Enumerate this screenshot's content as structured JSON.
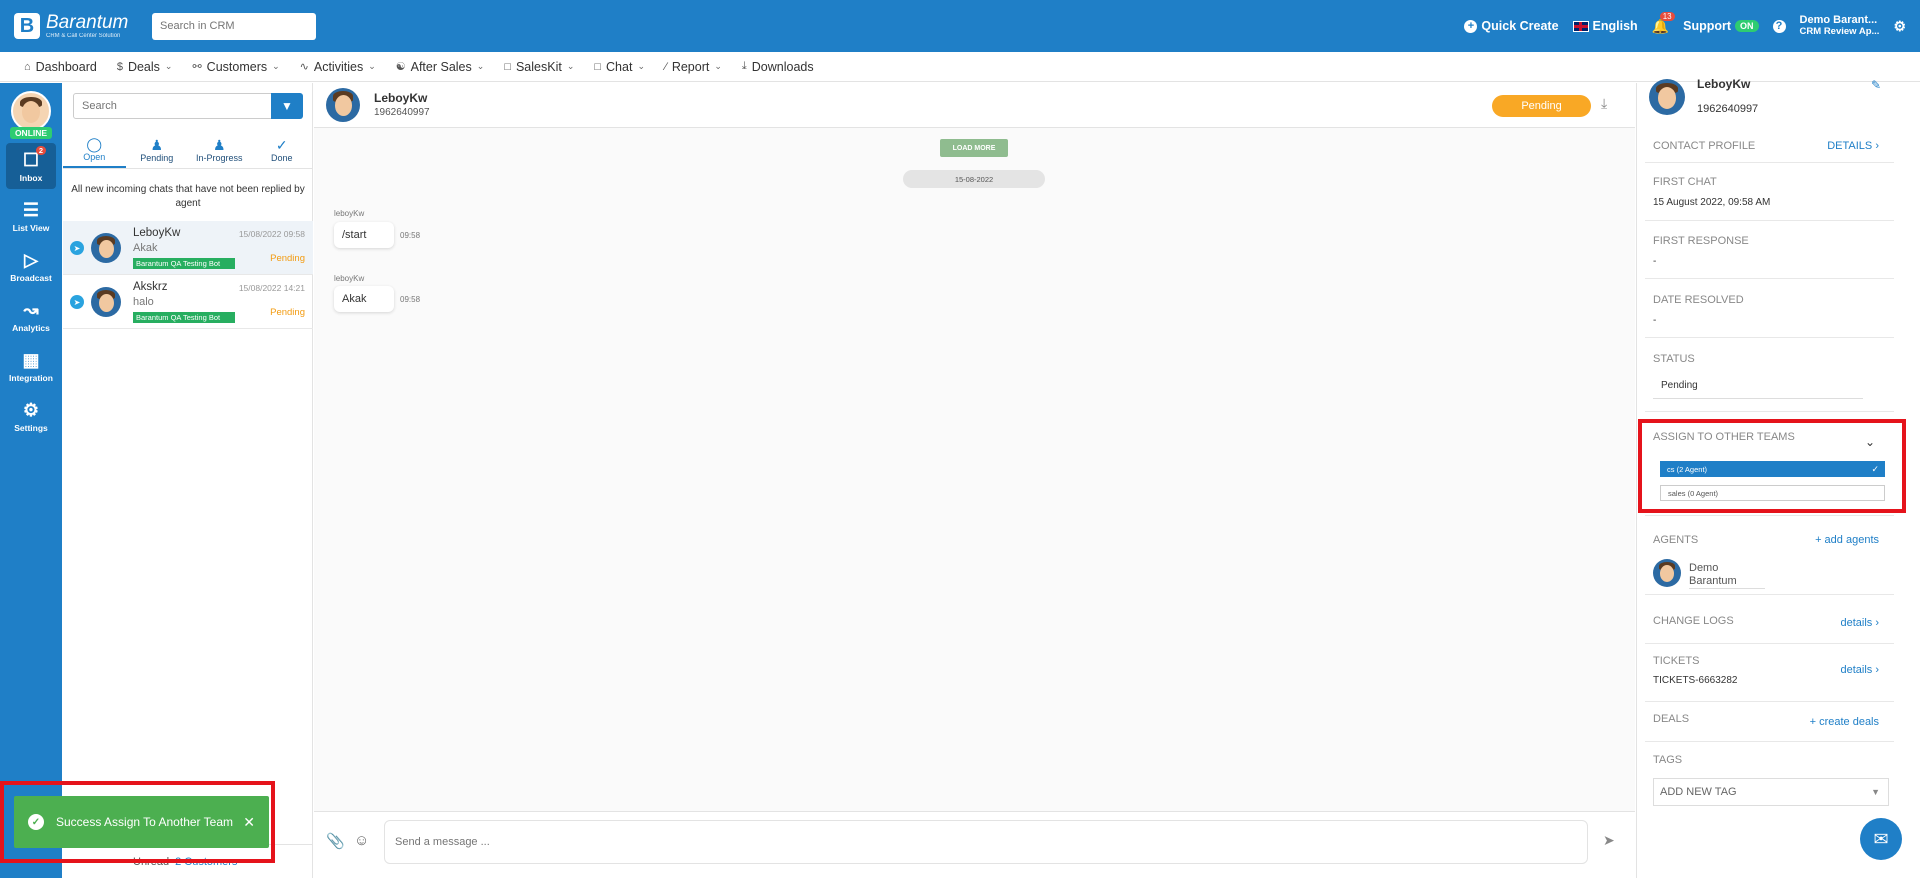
{
  "header": {
    "logo_name": "Barantum",
    "logo_tag": "CRM & Call Center Solution",
    "search_placeholder": "Search in CRM",
    "quick_create": "Quick Create",
    "language": "English",
    "notif_count": "13",
    "support": "Support",
    "support_status": "ON",
    "user_name": "Demo Barant...",
    "user_company": "CRM Review Ap..."
  },
  "nav": {
    "items": [
      {
        "label": "Dashboard",
        "icon": "home-icon",
        "dropdown": false
      },
      {
        "label": "Deals",
        "icon": "dollar-icon",
        "dropdown": true
      },
      {
        "label": "Customers",
        "icon": "users-icon",
        "dropdown": true
      },
      {
        "label": "Activities",
        "icon": "activity-icon",
        "dropdown": true
      },
      {
        "label": "After Sales",
        "icon": "handshake-icon",
        "dropdown": true
      },
      {
        "label": "SalesKit",
        "icon": "folder-icon",
        "dropdown": true
      },
      {
        "label": "Chat",
        "icon": "folder-icon",
        "dropdown": true
      },
      {
        "label": "Report",
        "icon": "chart-icon",
        "dropdown": true
      },
      {
        "label": "Downloads",
        "icon": "download-icon",
        "dropdown": false
      }
    ]
  },
  "rail": {
    "online": "ONLINE",
    "items": [
      {
        "label": "Inbox",
        "badge": "2"
      },
      {
        "label": "List View"
      },
      {
        "label": "Broadcast"
      },
      {
        "label": "Analytics"
      },
      {
        "label": "Integration"
      },
      {
        "label": "Settings"
      }
    ]
  },
  "list": {
    "search_placeholder": "Search",
    "tabs": [
      "Open",
      "Pending",
      "In-Progress",
      "Done"
    ],
    "note": "All new incoming chats that have not been replied by agent",
    "chats": [
      {
        "name": "LeboyKw",
        "message": "Akak",
        "time": "15/08/2022 09:58",
        "status": "Pending",
        "tag": "Barantum QA Testing Bot"
      },
      {
        "name": "Akskrz",
        "message": "halo",
        "time": "15/08/2022 14:21",
        "status": "Pending",
        "tag": "Barantum QA Testing Bot"
      }
    ],
    "footer_unread": "Unread",
    "footer_customers": "2 Customers"
  },
  "toast": {
    "message": "Success Assign To Another Team"
  },
  "conversation": {
    "name": "LeboyKw",
    "phone": "1962640997",
    "status": "Pending",
    "load_more": "LOAD MORE",
    "date": "15-08-2022",
    "messages": [
      {
        "sender": "leboyKw",
        "text": "/start",
        "time": "09:58"
      },
      {
        "sender": "leboyKw",
        "text": "Akak",
        "time": "09:58"
      }
    ],
    "input_placeholder": "Send a message ..."
  },
  "details": {
    "name": "LeboyKw",
    "phone": "1962640997",
    "contact_profile": "CONTACT PROFILE",
    "details_link": "DETAILS",
    "first_chat_label": "FIRST CHAT",
    "first_chat_value": "15 August 2022, 09:58 AM",
    "first_response_label": "FIRST RESPONSE",
    "first_response_value": "-",
    "date_resolved_label": "DATE RESOLVED",
    "date_resolved_value": "-",
    "status_label": "STATUS",
    "status_value": "Pending",
    "assign_label": "ASSIGN TO OTHER TEAMS",
    "teams": [
      {
        "label": "cs (2 Agent)",
        "selected": true
      },
      {
        "label": "sales (0 Agent)",
        "selected": false
      }
    ],
    "agents_label": "AGENTS",
    "add_agents": "+ add agents",
    "agent_name": "Demo Barantum",
    "change_logs_label": "CHANGE LOGS",
    "change_logs_link": "details",
    "tickets_label": "TICKETS",
    "tickets_link": "details",
    "ticket_value": "TICKETS-6663282",
    "deals_label": "DEALS",
    "create_deals": "+ create deals",
    "tags_label": "TAGS",
    "tag_placeholder": "ADD NEW TAG"
  },
  "colors": {
    "primary": "#1f7fc7",
    "pending": "#f9a825",
    "success": "#4caf50",
    "highlight": "#e5131b"
  }
}
